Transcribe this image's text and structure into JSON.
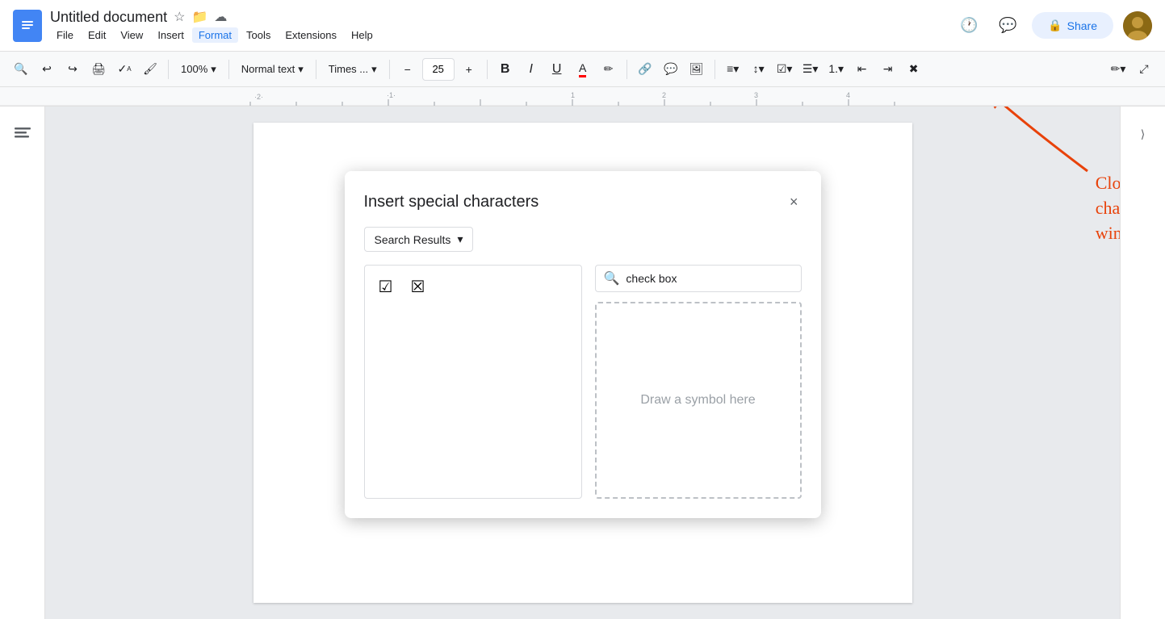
{
  "titlebar": {
    "doc_title": "Untitled document",
    "share_label": "Share",
    "menu": [
      "File",
      "Edit",
      "View",
      "Insert",
      "Format",
      "Tools",
      "Extensions",
      "Help"
    ]
  },
  "toolbar": {
    "zoom": "100%",
    "style_label": "Normal text",
    "font_label": "Times ...",
    "font_size": "25"
  },
  "dialog": {
    "title": "Insert special characters",
    "close_label": "×",
    "dropdown_label": "Search Results",
    "dropdown_arrow": "▾",
    "search_placeholder": "check box",
    "search_value": "check box",
    "draw_placeholder": "Draw a symbol here",
    "chars": [
      "☑",
      "☒"
    ]
  },
  "annotation": {
    "text": "Close the Special\ncharacter pop-up\nwindow",
    "color": "#e8420a"
  },
  "icons": {
    "search": "🔍",
    "undo": "↩",
    "redo": "↪",
    "print": "🖨",
    "spellcheck": "✓",
    "paintformat": "🖌",
    "bold": "B",
    "italic": "I",
    "underline": "U",
    "fontcolor": "A",
    "highlight": "✏",
    "link": "🔗",
    "comment": "💬",
    "image": "🖼",
    "align": "≡",
    "lineheight": "↕",
    "list": "☰",
    "numberedlist": "1.",
    "indent": "→",
    "outdent": "←",
    "clear": "✖",
    "pencil": "✏",
    "expand": "⤢",
    "history": "🕐",
    "chat": "💬",
    "lock": "🔒",
    "outline": "≡",
    "chevron_down": "▾",
    "minus": "−",
    "plus": "+"
  }
}
